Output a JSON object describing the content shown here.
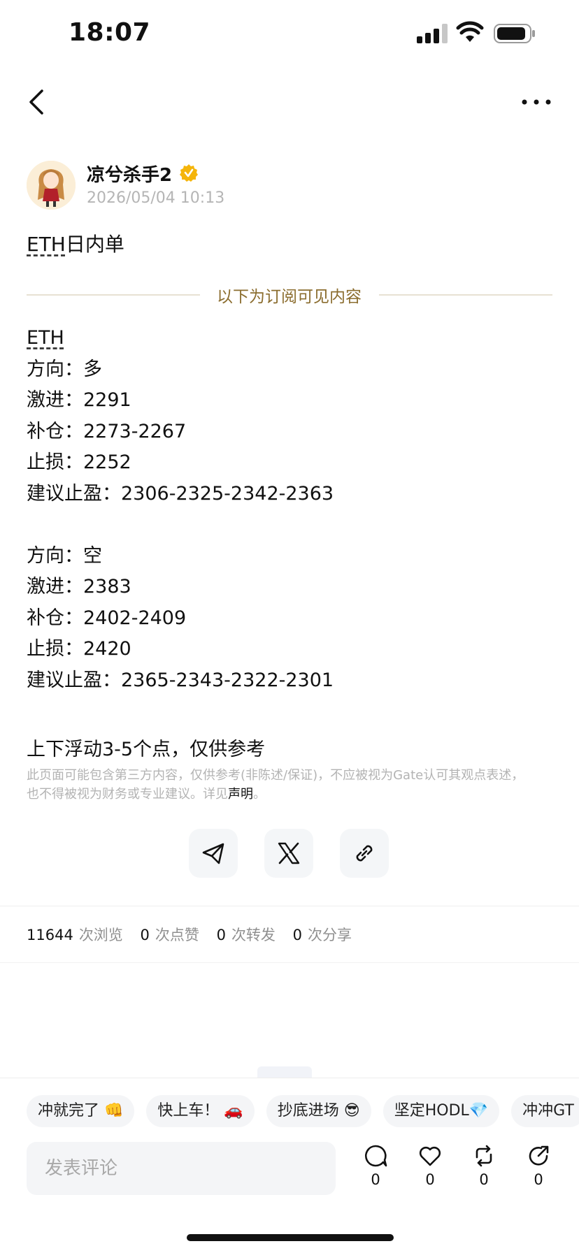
{
  "status_bar": {
    "time": "18:07"
  },
  "post": {
    "author": "凉兮杀手2",
    "date": "2026/05/04 10:13",
    "title_prefix": "ETH",
    "title_suffix": "日内单",
    "subscriber_divider": "以下为订阅可见内容",
    "asset": "ETH",
    "long": {
      "direction": "方向：多",
      "aggressive": "激进：2291",
      "add": "补仓：2273-2267",
      "stop": "止损：2252",
      "take_profit": "建议止盈：2306-2325-2342-2363"
    },
    "short": {
      "direction": "方向：空",
      "aggressive": "激进：2383",
      "add": "补仓：2402-2409",
      "stop": "止损：2420",
      "take_profit": "建议止盈：2365-2343-2322-2301"
    },
    "note": "上下浮动3-5个点，仅供参考",
    "disclaimer_text": "此页面可能包含第三方内容，仅供参考(非陈述/保证)，不应被视为Gate认可其观点表述，也不得被视为财务或专业建议。详见",
    "disclaimer_link": "声明",
    "disclaimer_end": "。"
  },
  "share": {
    "icons": [
      "telegram-icon",
      "x-icon",
      "link-icon"
    ]
  },
  "stats": {
    "views": "11644",
    "views_label": "次浏览",
    "likes": "0",
    "likes_label": "次点赞",
    "reposts": "0",
    "reposts_label": "次转发",
    "shares": "0",
    "shares_label": "次分享"
  },
  "quick_replies": [
    "冲就完了 👊",
    "快上车！ 🚗",
    "抄底进场 😎",
    "坚定HODL💎",
    "冲冲GT"
  ],
  "comment": {
    "placeholder": "发表评论"
  },
  "actions": {
    "comments": "0",
    "likes": "0",
    "reposts": "0",
    "shares": "0"
  },
  "colors": {
    "verify_badge": "#f5b50a",
    "divider_text": "#8b6d2f",
    "muted": "#b3b3b3"
  }
}
